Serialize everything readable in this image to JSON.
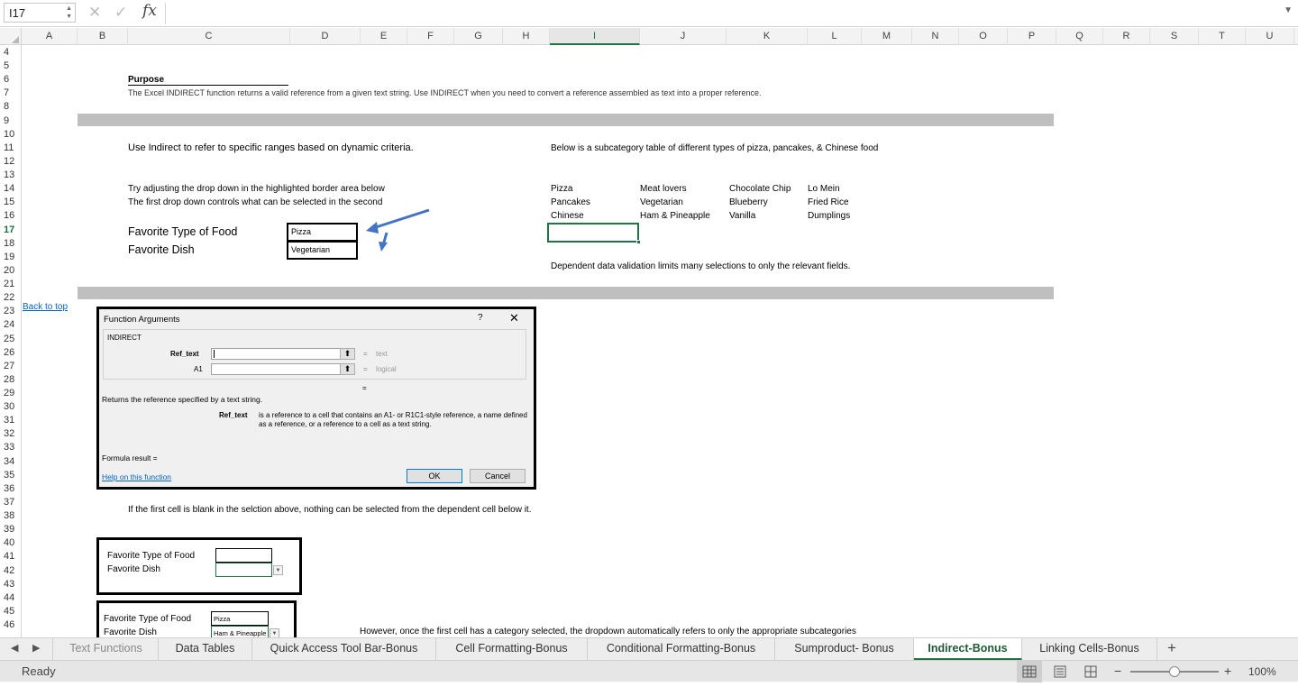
{
  "formula_bar": {
    "name_box": "I17",
    "fx": "fx",
    "cancel_icon": "✕",
    "enter_icon": "✓"
  },
  "columns": [
    "A",
    "B",
    "C",
    "D",
    "E",
    "F",
    "G",
    "H",
    "I",
    "J",
    "K",
    "L",
    "M",
    "N",
    "O",
    "P",
    "Q",
    "R",
    "S",
    "T",
    "U"
  ],
  "selected_column": "I",
  "rows": [
    "4",
    "5",
    "6",
    "7",
    "8",
    "9",
    "10",
    "11",
    "12",
    "13",
    "14",
    "15",
    "16",
    "17",
    "18",
    "19",
    "20",
    "21",
    "22",
    "23",
    "24",
    "25",
    "26",
    "27",
    "28",
    "29",
    "30",
    "31",
    "32",
    "33",
    "34",
    "35",
    "36",
    "37",
    "38",
    "39",
    "40",
    "41",
    "42",
    "43",
    "44",
    "45",
    "46"
  ],
  "selected_row": "17",
  "content": {
    "purpose_title": "Purpose",
    "purpose_text": "The Excel INDIRECT function returns a valid reference from a given text string. Use INDIRECT when you need to convert a reference assembled as text into a proper reference.",
    "use_indirect": "Use Indirect to refer to specific ranges based on dynamic criteria.",
    "subcategory_intro": "Below is a subcategory table of different types of pizza, pancakes, & Chinese food",
    "try_adjusting": "Try adjusting the drop down in the highlighted border area below",
    "first_dropdown": "The first drop down controls what can be selected in the second",
    "fav_type_label": "Favorite Type of Food",
    "fav_dish_label": "Favorite Dish",
    "fav_type_value": "Pizza",
    "fav_dish_value": "Vegetarian",
    "table": [
      [
        "Pizza",
        "Meat lovers",
        "Chocolate Chip",
        "Lo Mein"
      ],
      [
        "Pancakes",
        "Vegetarian",
        "Blueberry",
        "Fried Rice"
      ],
      [
        "Chinese",
        "Ham & Pineapple",
        "Vanilla",
        "Dumplings"
      ]
    ],
    "dependent_note": "Dependent data validation limits many selections to only the relevant fields.",
    "back_to_top": "Back to top",
    "blank_note": "If the first cell is blank in the selction above, nothing can be selected from the dependent cell below it.",
    "box2_type_label": "Favorite Type of Food",
    "box2_dish_label": "Favorite Dish",
    "box3_type_label": "Favorite Type of Food",
    "box3_dish_label": "Favorite Dish",
    "box3_type_value": "Pizza",
    "box3_dish_value": "Ham & Pineapple",
    "however_note": "However, once the first cell has a category selected, the dropdown automatically refers to only the appropriate subcategories"
  },
  "dialog": {
    "title": "Function Arguments",
    "help_glyph": "?",
    "close_glyph": "✕",
    "function_name": "INDIRECT",
    "arg1_label": "Ref_text",
    "arg1_result": "text",
    "arg2_label": "A1",
    "arg2_result": "logical",
    "equals": "=",
    "description": "Returns the reference specified by a text string.",
    "arg_desc_label": "Ref_text",
    "arg_desc": "is a reference to a cell that contains an A1- or R1C1-style reference, a name defined as a reference, or a reference to a cell as a text string.",
    "formula_result": "Formula result =",
    "help_link": "Help on this function",
    "ok": "OK",
    "cancel": "Cancel"
  },
  "tabs": [
    "Text Functions",
    "Data Tables",
    "Quick Access Tool Bar-Bonus",
    "Cell Formatting-Bonus",
    "Conditional Formatting-Bonus",
    "Sumproduct- Bonus",
    "Indirect-Bonus",
    "Linking Cells-Bonus"
  ],
  "active_tab": "Indirect-Bonus",
  "add_sheet": "+",
  "status": {
    "ready": "Ready",
    "zoom": "100%",
    "zoom_minus": "−",
    "zoom_plus": "+"
  },
  "colors": {
    "accent": "#217346",
    "band": "#bfbfbf",
    "arrow": "#4472c4",
    "link": "#0563c1"
  }
}
